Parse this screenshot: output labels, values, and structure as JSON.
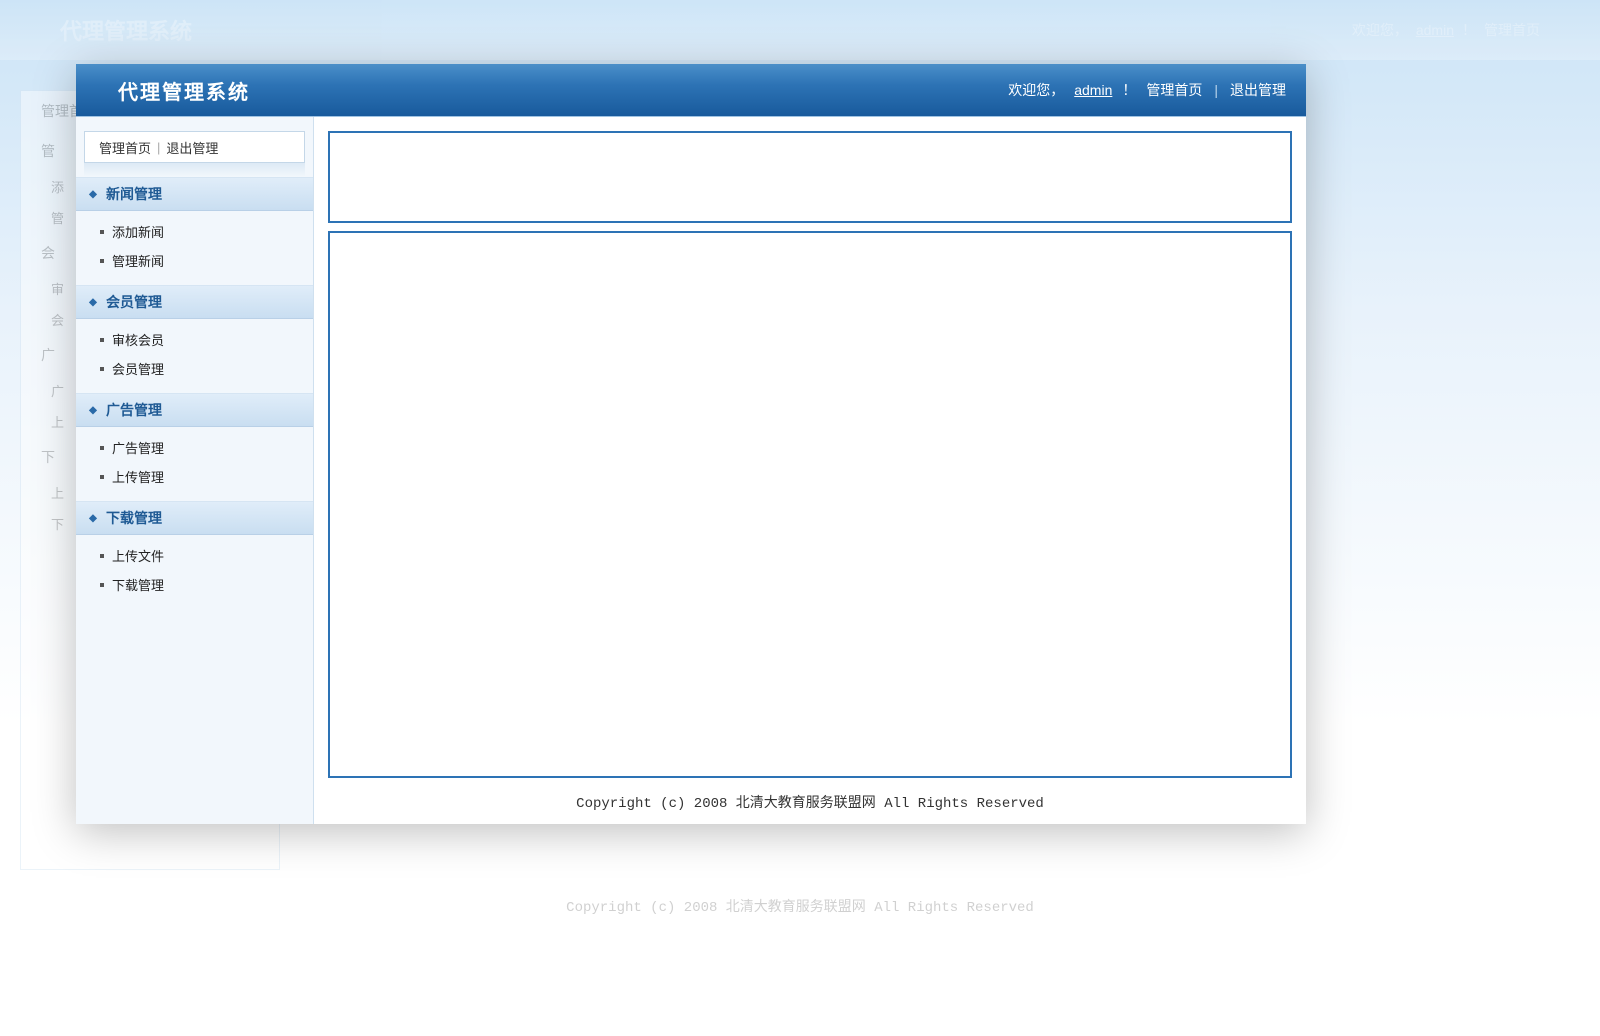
{
  "app_title": "代理管理系统",
  "header": {
    "welcome_prefix": "欢迎您，",
    "username": "admin",
    "username_suffix": "！",
    "home_link": "管理首页",
    "logout_link": "退出管理"
  },
  "bg_header": {
    "welcome_prefix": "欢迎您，",
    "username": "admin",
    "username_suffix": "！",
    "home_link": "管理首页"
  },
  "sidebar_tabs": {
    "home": "管理首页",
    "logout": "退出管理"
  },
  "nav": [
    {
      "title": "新闻管理",
      "items": [
        "添加新闻",
        "管理新闻"
      ]
    },
    {
      "title": "会员管理",
      "items": [
        "审核会员",
        "会员管理"
      ]
    },
    {
      "title": "广告管理",
      "items": [
        "广告管理",
        "上传管理"
      ]
    },
    {
      "title": "下载管理",
      "items": [
        "上传文件",
        "下载管理"
      ]
    }
  ],
  "bg_nav": [
    {
      "title": "管",
      "items": [
        "添",
        "管"
      ]
    },
    {
      "title": "会",
      "items": [
        "审",
        "会"
      ]
    },
    {
      "title": "广",
      "items": [
        "广",
        "上"
      ]
    },
    {
      "title": "下",
      "items": [
        "上",
        "下"
      ]
    }
  ],
  "footer": "Copyright (c) 2008 北清大教育服务联盟网 All Rights Reserved"
}
